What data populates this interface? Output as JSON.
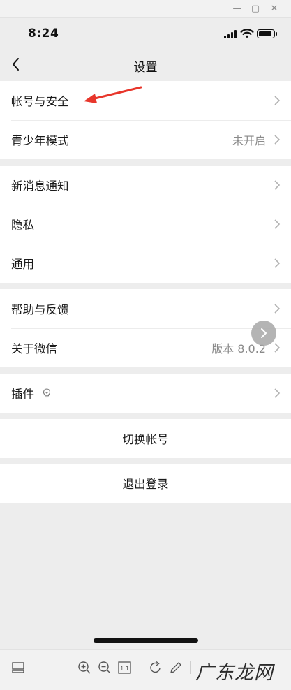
{
  "status_bar": {
    "time": "8:24"
  },
  "nav": {
    "title": "设置"
  },
  "groups": [
    {
      "rows": [
        {
          "label": "帐号与安全"
        },
        {
          "label": "青少年模式",
          "value": "未开启"
        }
      ]
    },
    {
      "rows": [
        {
          "label": "新消息通知"
        },
        {
          "label": "隐私"
        },
        {
          "label": "通用"
        }
      ]
    },
    {
      "rows": [
        {
          "label": "帮助与反馈"
        },
        {
          "label": "关于微信",
          "value": "版本 8.0.2"
        }
      ]
    },
    {
      "rows": [
        {
          "label": "插件"
        }
      ]
    },
    {
      "rows": [
        {
          "label": "切换帐号"
        }
      ]
    },
    {
      "rows": [
        {
          "label": "退出登录"
        }
      ]
    }
  ],
  "watermark": {
    "text": "广东龙网"
  },
  "colors": {
    "arrow": "#e8362b",
    "background": "#ededed"
  }
}
